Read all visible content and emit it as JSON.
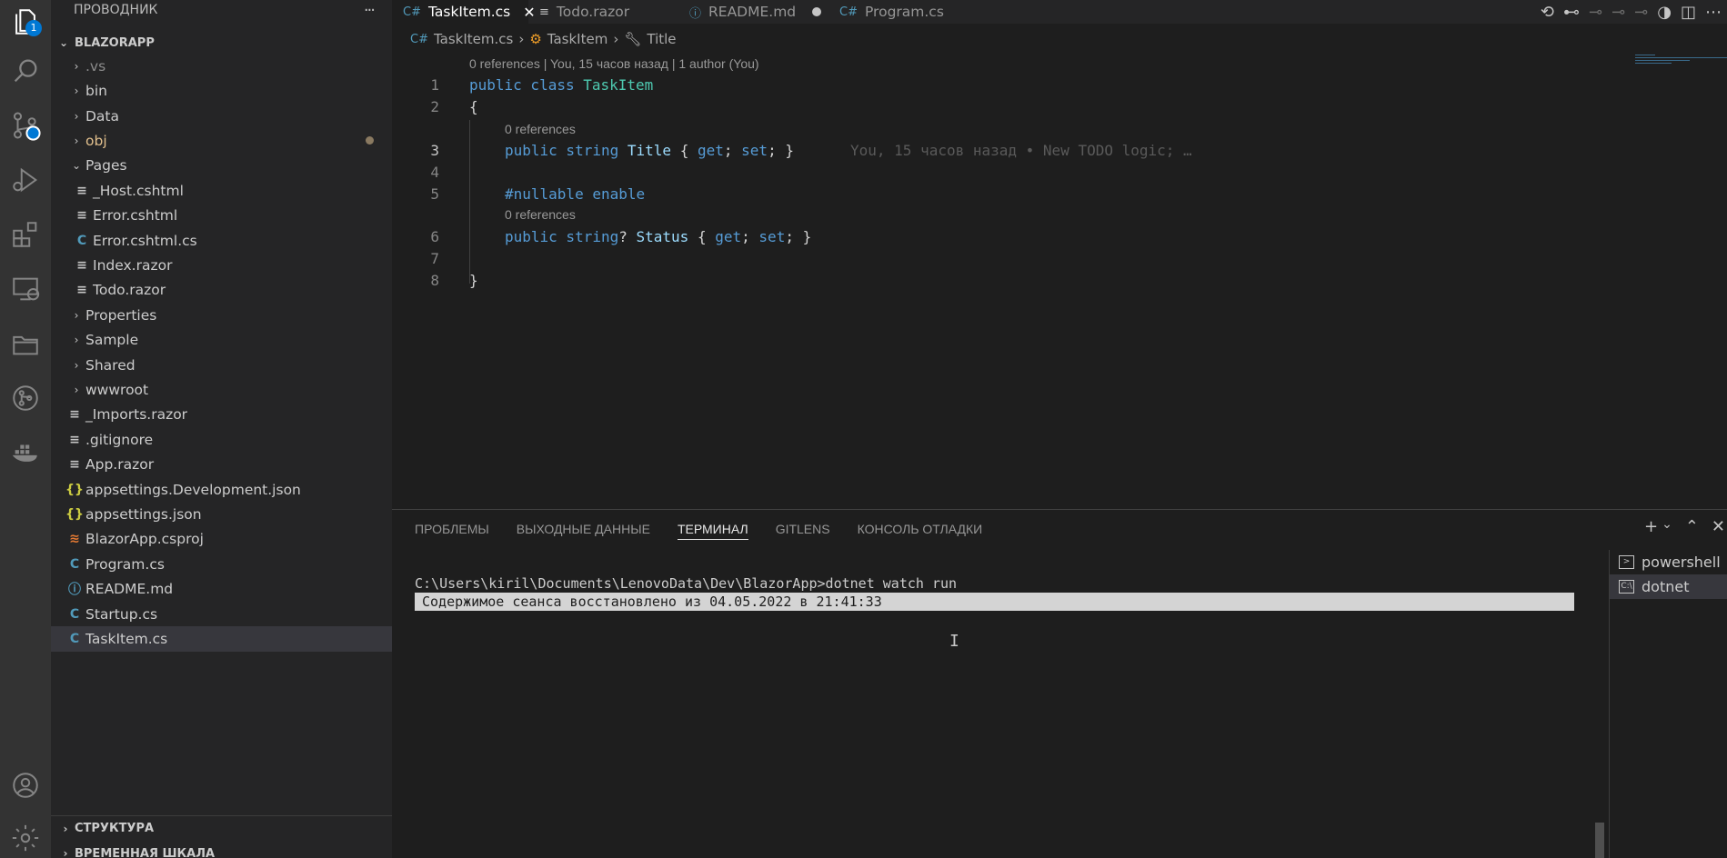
{
  "activity": {
    "scm_badge": "1"
  },
  "explorer": {
    "title": "ПРОВОДНИК",
    "more": "···",
    "root": "BLAZORAPP",
    "items": [
      {
        "label": ".vs",
        "kind": "folder",
        "level": 0,
        "open": false,
        "color": "#8b8b8b"
      },
      {
        "label": "bin",
        "kind": "folder",
        "level": 0,
        "open": false,
        "color": "#cccccc"
      },
      {
        "label": "Data",
        "kind": "folder",
        "level": 0,
        "open": false,
        "color": "#cccccc"
      },
      {
        "label": "obj",
        "kind": "folder",
        "level": 0,
        "open": false,
        "color": "#e2c08d"
      },
      {
        "label": "Pages",
        "kind": "folder",
        "level": 0,
        "open": true,
        "color": "#cccccc"
      },
      {
        "label": "_Host.cshtml",
        "kind": "lines",
        "level": 1,
        "color": "#cccccc"
      },
      {
        "label": "Error.cshtml",
        "kind": "lines",
        "level": 1,
        "color": "#cccccc"
      },
      {
        "label": "Error.cshtml.cs",
        "kind": "cs",
        "level": 1,
        "color": "#cccccc"
      },
      {
        "label": "Index.razor",
        "kind": "lines",
        "level": 1,
        "color": "#cccccc"
      },
      {
        "label": "Todo.razor",
        "kind": "lines",
        "level": 1,
        "color": "#cccccc"
      },
      {
        "label": "Properties",
        "kind": "folder",
        "level": 0,
        "open": false,
        "color": "#cccccc"
      },
      {
        "label": "Sample",
        "kind": "folder",
        "level": 0,
        "open": false,
        "color": "#cccccc"
      },
      {
        "label": "Shared",
        "kind": "folder",
        "level": 0,
        "open": false,
        "color": "#cccccc"
      },
      {
        "label": "wwwroot",
        "kind": "folder",
        "level": 0,
        "open": false,
        "color": "#cccccc"
      },
      {
        "label": "_Imports.razor",
        "kind": "lines",
        "level": 0,
        "color": "#cccccc"
      },
      {
        "label": ".gitignore",
        "kind": "lines",
        "level": 0,
        "color": "#cccccc"
      },
      {
        "label": "App.razor",
        "kind": "lines",
        "level": 0,
        "color": "#cccccc"
      },
      {
        "label": "appsettings.Development.json",
        "kind": "json",
        "level": 0,
        "color": "#cccccc"
      },
      {
        "label": "appsettings.json",
        "kind": "json",
        "level": 0,
        "color": "#cccccc"
      },
      {
        "label": "BlazorApp.csproj",
        "kind": "rss",
        "level": 0,
        "color": "#cccccc"
      },
      {
        "label": "Program.cs",
        "kind": "cs",
        "level": 0,
        "color": "#cccccc"
      },
      {
        "label": "README.md",
        "kind": "info",
        "level": 0,
        "color": "#cccccc"
      },
      {
        "label": "Startup.cs",
        "kind": "cs",
        "level": 0,
        "color": "#cccccc"
      },
      {
        "label": "TaskItem.cs",
        "kind": "cs",
        "level": 0,
        "color": "#cccccc",
        "selected": true
      }
    ],
    "outline": "СТРУКТУРА",
    "timeline": "ВРЕМЕННАЯ ШКАЛА"
  },
  "tabs": [
    {
      "label": "TaskItem.cs",
      "icon": "C#",
      "active": true
    },
    {
      "label": "Todo.razor",
      "icon": "≡"
    },
    {
      "label": "README.md",
      "icon": "ⓘ",
      "dirty": true
    },
    {
      "label": "Program.cs",
      "icon": "C#"
    }
  ],
  "breadcrumb": {
    "file": "TaskItem.cs",
    "class": "TaskItem",
    "member": "Title"
  },
  "codelens": {
    "class_lens": "0 references | You, 15 часов назад | 1 author (You)",
    "title_lens": "0 references",
    "status_lens": "0 references"
  },
  "code": {
    "line_numbers": [
      "1",
      "2",
      "3",
      "4",
      "5",
      "6",
      "7",
      "8"
    ],
    "l1_kw": "public class",
    "l1_cls": "TaskItem",
    "l2": "{",
    "l3_kw": "public string",
    "l3_prop": "Title",
    "l3_open": "{",
    "l3_get": "get",
    "l3_semi1": ";",
    "l3_set": "set",
    "l3_close": "; }",
    "l3_blame": "You, 15 часов назад • New TODO logic; …",
    "l5": "#nullable enable",
    "l6_kw": "public string",
    "l6_q": "?",
    "l6_prop": "Status",
    "l6_open": "{",
    "l6_get": "get",
    "l6_semi1": ";",
    "l6_set": "set",
    "l6_close": "; }",
    "l8": "}"
  },
  "panel": {
    "tabs": [
      "ПРОБЛЕМЫ",
      "ВЫХОДНЫЕ ДАННЫЕ",
      "ТЕРМИНАЛ",
      "GITLENS",
      "КОНСОЛЬ ОТЛАДКИ"
    ],
    "active_tab": "ТЕРМИНАЛ",
    "terminal_line": "C:\\Users\\kiril\\Documents\\LenovoData\\Dev\\BlazorApp>dotnet watch run",
    "terminal_notice": "Содержимое сеанса восстановлено из 04.05.2022 в 21:41:33",
    "terminals": [
      "powershell",
      "dotnet"
    ]
  }
}
